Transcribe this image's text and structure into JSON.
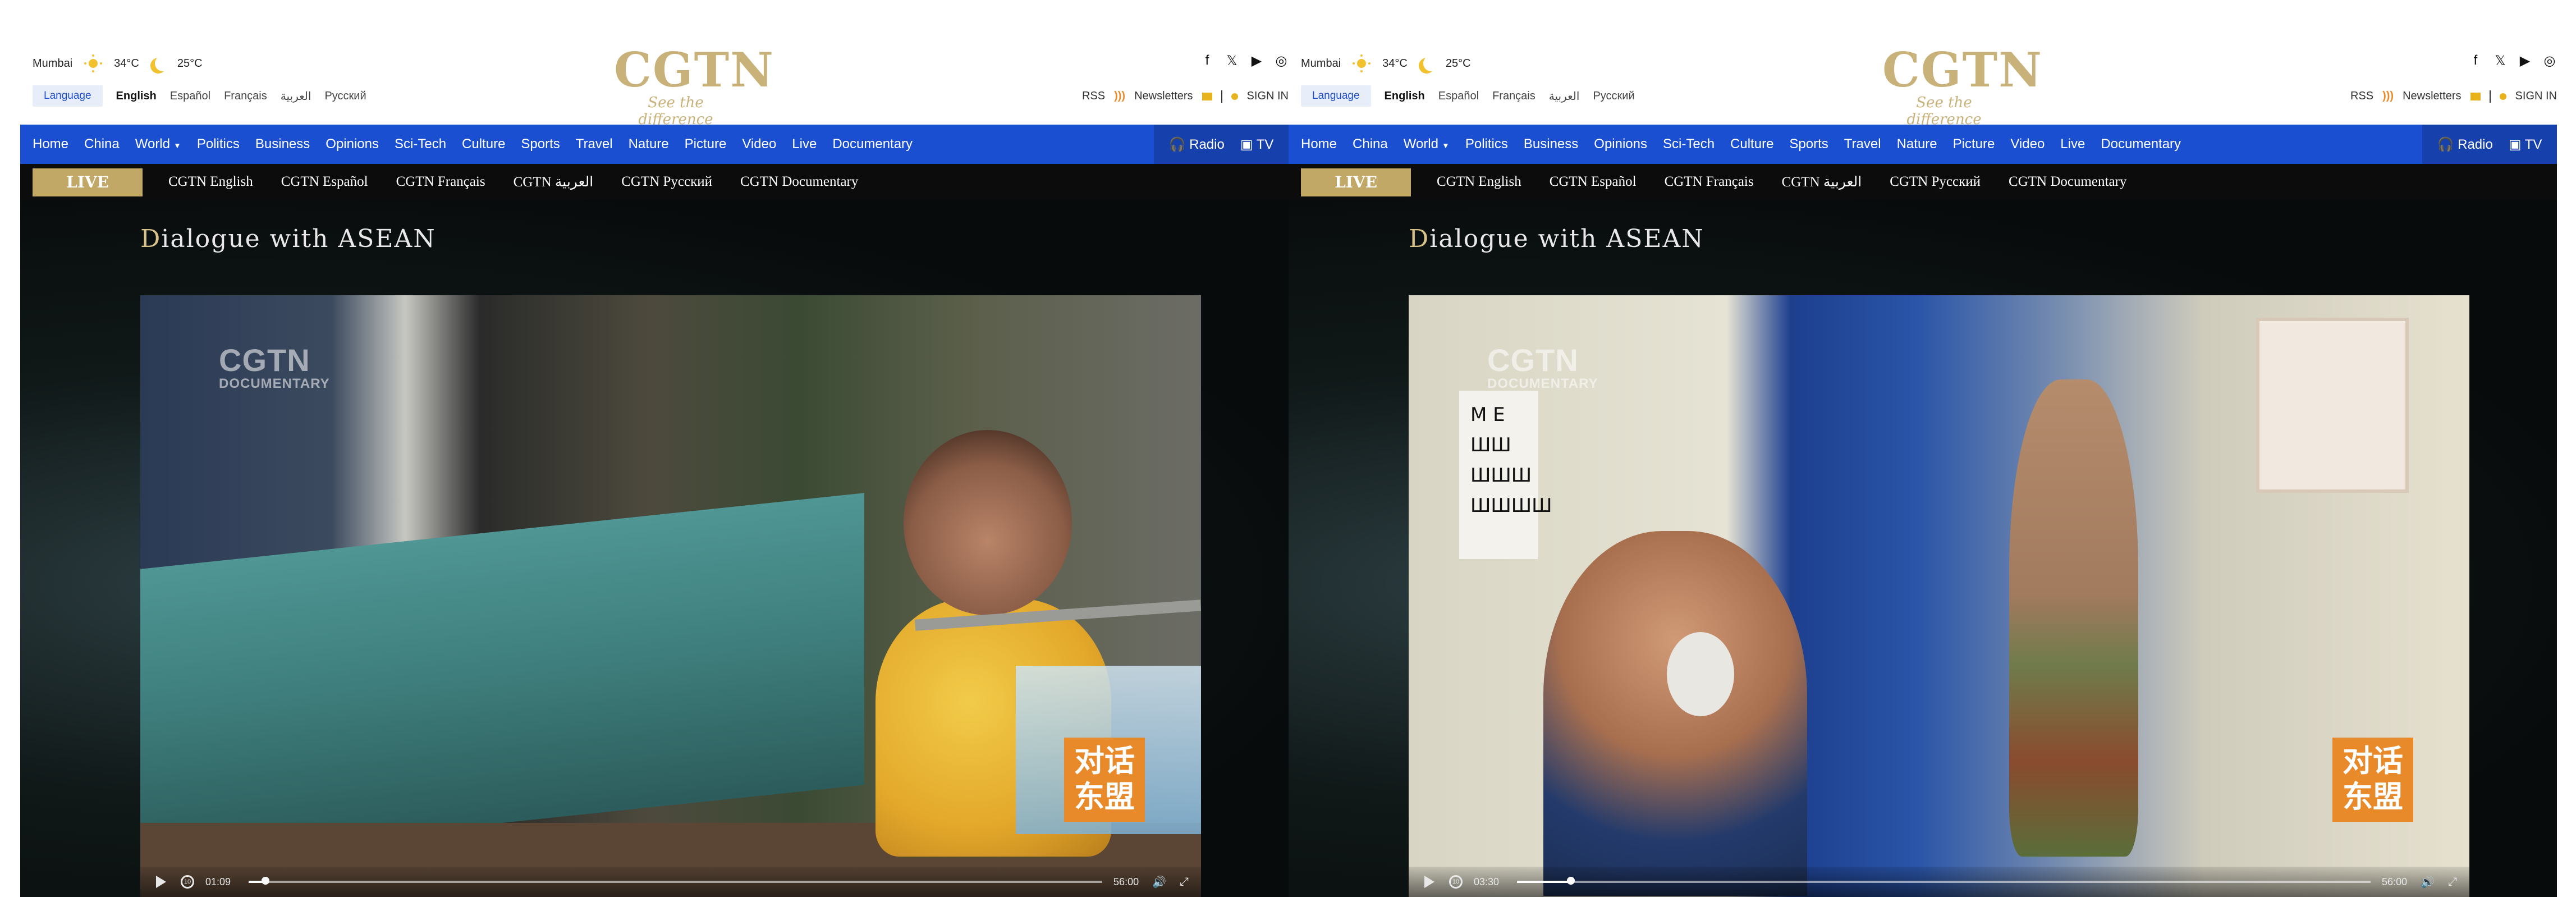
{
  "header": {
    "city": "Mumbai",
    "temp_day": "34°C",
    "temp_night": "25°C",
    "language_button": "Language",
    "languages": [
      "English",
      "Español",
      "Français",
      "العربية",
      "Русский"
    ],
    "logo_text": "CGTN",
    "tagline": "See the difference",
    "social_icons": [
      "facebook-icon",
      "x-icon",
      "youtube-icon",
      "instagram-icon"
    ],
    "rss": "RSS",
    "newsletters": "Newsletters",
    "sign_in_left": "SIGN IN",
    "sign_in_right": "SIGN IN"
  },
  "nav": {
    "items": [
      "Home",
      "China",
      "World",
      "Politics",
      "Business",
      "Opinions",
      "Sci-Tech",
      "Culture",
      "Sports",
      "Travel",
      "Nature",
      "Picture",
      "Video",
      "Live",
      "Documentary"
    ],
    "radio": "Radio",
    "tv": "TV"
  },
  "live": {
    "badge": "LIVE",
    "channels": [
      "CGTN English",
      "CGTN Español",
      "CGTN Français",
      "CGTN العربية",
      "CGTN Русский",
      "CGTN Documentary"
    ]
  },
  "stage": {
    "title_first": "D",
    "title_rest": "ialogue with ASEAN"
  },
  "video": {
    "watermark_main": "CGTN",
    "watermark_sub": "DOCUMENTARY",
    "badge_line1": "对话",
    "badge_line2": "东盟"
  },
  "left_player": {
    "current_time": "01:09",
    "duration": "56:00",
    "progress": 0.02
  },
  "right_player": {
    "current_time": "03:30",
    "duration": "56:00",
    "progress": 0.063
  },
  "colors": {
    "nav_blue": "#1b4fd1",
    "gold": "#c9b27a",
    "live_badge": "#c2a866",
    "badge_orange": "#e98a2a"
  }
}
